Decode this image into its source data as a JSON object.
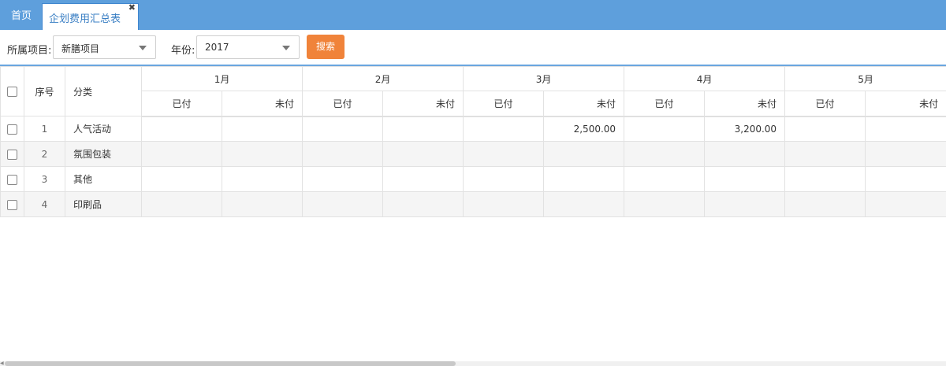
{
  "tabs": {
    "home": "首页",
    "active": "企划费用汇总表",
    "close_glyph": "✖"
  },
  "toolbar": {
    "project_label": "所属项目:",
    "project_value": "新膳项目",
    "year_label": "年份:",
    "year_value": "2017",
    "search_button": "搜索"
  },
  "table": {
    "col_index": "序号",
    "col_category": "分类",
    "months": [
      "1月",
      "2月",
      "3月",
      "4月",
      "5月"
    ],
    "sub_paid": "已付",
    "sub_unpaid": "未付",
    "rows": [
      {
        "index": "1",
        "category": "人气活动",
        "cells": [
          "",
          "",
          "",
          "",
          "",
          "2,500.00",
          "",
          "3,200.00",
          "",
          ""
        ]
      },
      {
        "index": "2",
        "category": "氛围包装",
        "cells": [
          "",
          "",
          "",
          "",
          "",
          "",
          "",
          "",
          "",
          ""
        ]
      },
      {
        "index": "3",
        "category": "其他",
        "cells": [
          "",
          "",
          "",
          "",
          "",
          "",
          "",
          "",
          "",
          ""
        ]
      },
      {
        "index": "4",
        "category": "印刷品",
        "cells": [
          "",
          "",
          "",
          "",
          "",
          "",
          "",
          "",
          "",
          ""
        ]
      }
    ]
  }
}
